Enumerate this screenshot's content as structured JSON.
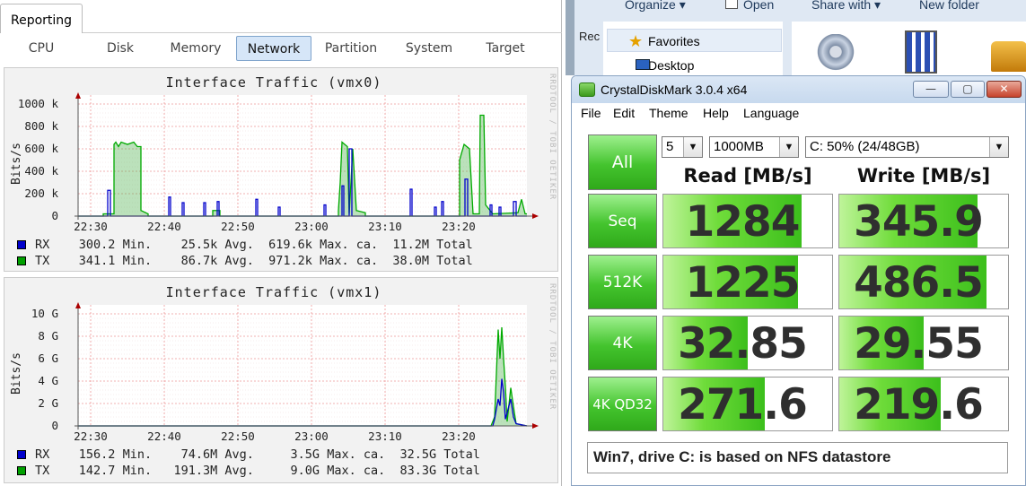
{
  "reporting": {
    "tab_label": "Reporting",
    "subtabs": [
      "CPU",
      "Disk",
      "Memory",
      "Network",
      "Partition",
      "System",
      "Target"
    ],
    "active_subtab": "Network",
    "sidebar_text": "RRDTOOL / TOBI OETIKER",
    "graphs": [
      {
        "title": "Interface Traffic (vmx0)",
        "ylabel": "Bits/s",
        "yticks": [
          "1000 k",
          "800 k",
          "600 k",
          "400 k",
          "200 k",
          "0"
        ],
        "xticks": [
          "22:30",
          "22:40",
          "22:50",
          "23:00",
          "23:10",
          "23:20"
        ],
        "legend": [
          {
            "swatch_color": "#0000cc",
            "name": "RX",
            "cur": "300.2",
            "min_label": "Min.",
            "min": "25.5k",
            "avg_label": "Avg.",
            "avg": "619.6k",
            "max_label": "Max.",
            "ca": "ca.",
            "total": "11.2M",
            "total_label": "Total"
          },
          {
            "swatch_color": "#00a000",
            "name": "TX",
            "cur": "341.1",
            "min_label": "Min.",
            "min": "86.7k",
            "avg_label": "Avg.",
            "avg": "971.2k",
            "max_label": "Max.",
            "ca": "ca.",
            "total": "38.0M",
            "total_label": "Total"
          }
        ]
      },
      {
        "title": "Interface Traffic (vmx1)",
        "ylabel": "Bits/s",
        "yticks": [
          "10 G",
          "8 G",
          "6 G",
          "4 G",
          "2 G",
          "0"
        ],
        "xticks": [
          "22:30",
          "22:40",
          "22:50",
          "23:00",
          "23:10",
          "23:20"
        ],
        "legend": [
          {
            "swatch_color": "#0000cc",
            "name": "RX",
            "cur": "156.2",
            "min_label": "Min.",
            "min": "74.6M",
            "avg_label": "Avg.",
            "avg": "3.5G",
            "max_label": "Max.",
            "ca": "ca.",
            "total": "32.5G",
            "total_label": "Total"
          },
          {
            "swatch_color": "#00a000",
            "name": "TX",
            "cur": "142.7",
            "min_label": "Min.",
            "min": "191.3M",
            "avg_label": "Avg.",
            "avg": "9.0G",
            "max_label": "Max.",
            "ca": "ca.",
            "total": "83.3G",
            "total_label": "Total"
          }
        ]
      }
    ]
  },
  "explorer": {
    "toolbar": [
      "Organize",
      "Open",
      "Share with",
      "New folder"
    ],
    "nav": [
      "Favorites",
      "Desktop"
    ],
    "side_fragment": "Rec"
  },
  "cdm": {
    "title": "CrystalDiskMark 3.0.4 x64",
    "menu": [
      "File",
      "Edit",
      "Theme",
      "Help",
      "Language"
    ],
    "all_label": "All",
    "runs": "5",
    "size": "1000MB",
    "drive": "C: 50% (24/48GB)",
    "read_header": "Read [MB/s]",
    "write_header": "Write [MB/s]",
    "rows": [
      {
        "label": "Seq",
        "read": "1284",
        "write": "345.9",
        "read_fill": 0.82,
        "write_fill": 0.82
      },
      {
        "label": "512K",
        "read": "1225",
        "write": "486.5",
        "read_fill": 0.8,
        "write_fill": 0.87
      },
      {
        "label": "4K",
        "read": "32.85",
        "write": "29.55",
        "read_fill": 0.5,
        "write_fill": 0.5
      },
      {
        "label": "4K QD32",
        "read": "271.6",
        "write": "219.6",
        "read_fill": 0.6,
        "write_fill": 0.6
      }
    ],
    "comment": "Win7, drive C: is based on NFS datastore"
  }
}
